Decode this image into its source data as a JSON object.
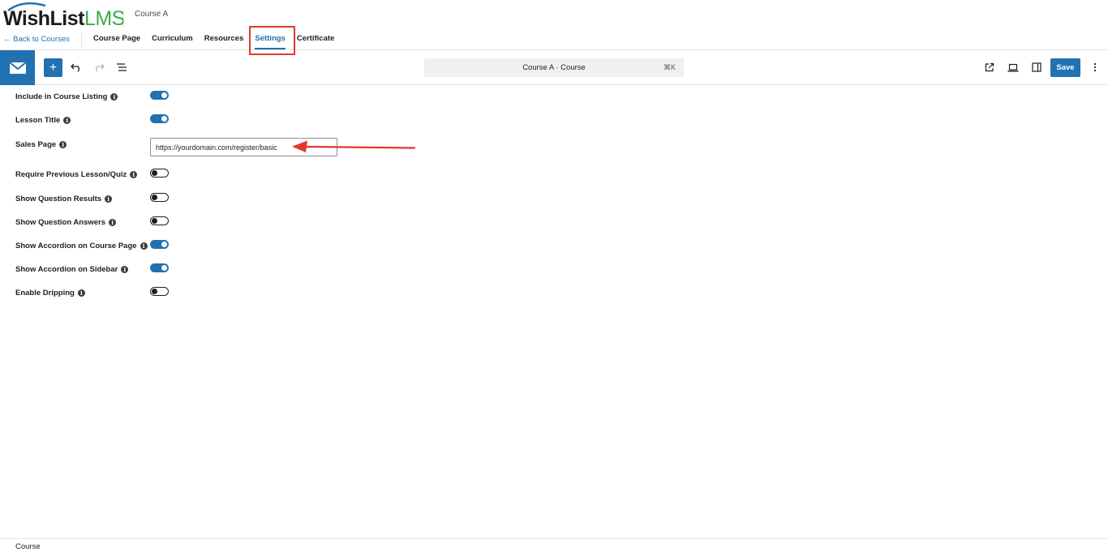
{
  "header": {
    "logo": {
      "wish_list": "WishList",
      "lms": "LMS"
    },
    "course_name": "Course A",
    "back_link": "← Back to Courses",
    "tabs": [
      {
        "label": "Course Page",
        "active": false
      },
      {
        "label": "Curriculum",
        "active": false
      },
      {
        "label": "Resources",
        "active": false
      },
      {
        "label": "Settings",
        "active": true
      },
      {
        "label": "Certificate",
        "active": false
      }
    ]
  },
  "toolbar": {
    "add_icon": "plus-icon",
    "undo_icon": "undo-icon",
    "redo_icon": "redo-icon",
    "outline_icon": "list-view-icon",
    "command_title": "Course A · Course",
    "command_shortcut": "⌘K",
    "view_icon": "external-link-icon",
    "preview_icon": "laptop-icon",
    "sidebar_icon": "sidebar-icon",
    "save_label": "Save",
    "more_icon": "more-vertical-icon"
  },
  "settings": {
    "include_listing": {
      "label": "Include in Course Listing",
      "enabled": true
    },
    "lesson_title": {
      "label": "Lesson Title",
      "enabled": true
    },
    "sales_page": {
      "label": "Sales Page",
      "value": "https://yourdomain.com/register/basic"
    },
    "require_previous": {
      "label": "Require Previous Lesson/Quiz",
      "enabled": false
    },
    "question_results": {
      "label": "Show Question Results",
      "enabled": false
    },
    "question_answers": {
      "label": "Show Question Answers",
      "enabled": false
    },
    "accordion_course_page": {
      "label": "Show Accordion on Course Page",
      "enabled": true
    },
    "accordion_sidebar": {
      "label": "Show Accordion on Sidebar",
      "enabled": true
    },
    "enable_dripping": {
      "label": "Enable Dripping",
      "enabled": false
    }
  },
  "footer": {
    "breadcrumb": "Course"
  },
  "colors": {
    "accent": "#2271b1",
    "highlight": "#e1392d",
    "logo_green": "#3bab49"
  }
}
